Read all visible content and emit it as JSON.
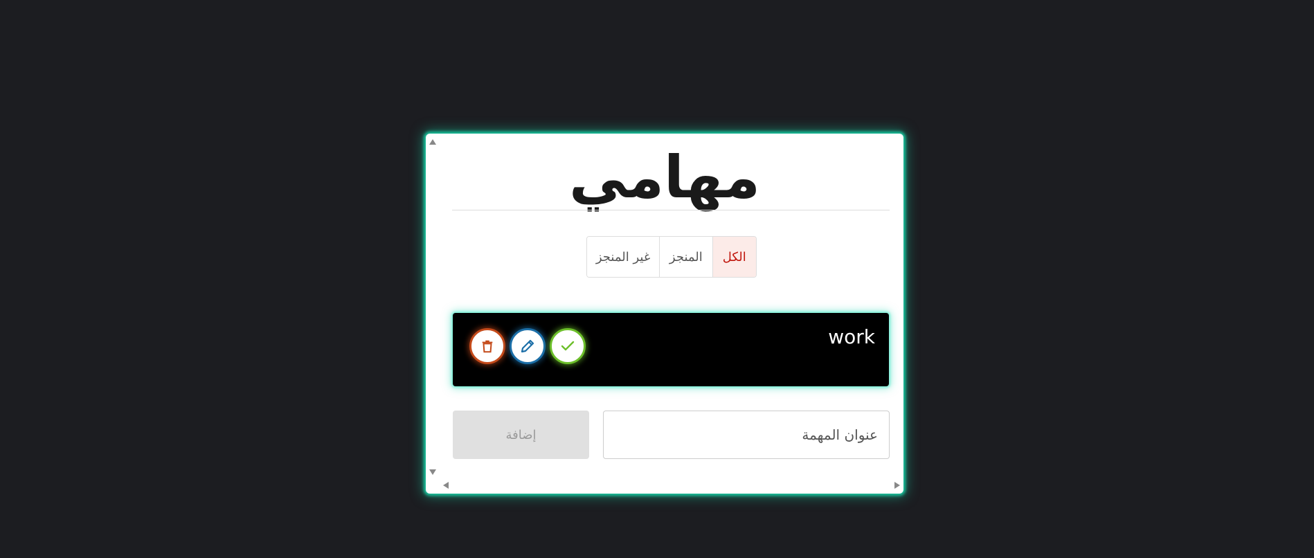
{
  "app": {
    "title": "مهامي"
  },
  "filters": {
    "all_label": "الكل",
    "done_label": "المنجز",
    "undone_label": "غير المنجز",
    "active": "all"
  },
  "tasks": [
    {
      "title": "work",
      "actions": {
        "delete_icon": "trash-icon",
        "edit_icon": "pencil-icon",
        "complete_icon": "check-icon"
      }
    }
  ],
  "add_form": {
    "input_placeholder": "عنوان المهمة",
    "input_value": "",
    "add_label": "إضافة"
  },
  "colors": {
    "accent_glow": "#19c39c",
    "active_filter_text": "#c0150c",
    "active_filter_bg": "#fcebe8",
    "delete": "#c44a1a",
    "edit": "#1c6fa8",
    "complete": "#6cbf2a",
    "task_bg": "#000000"
  }
}
